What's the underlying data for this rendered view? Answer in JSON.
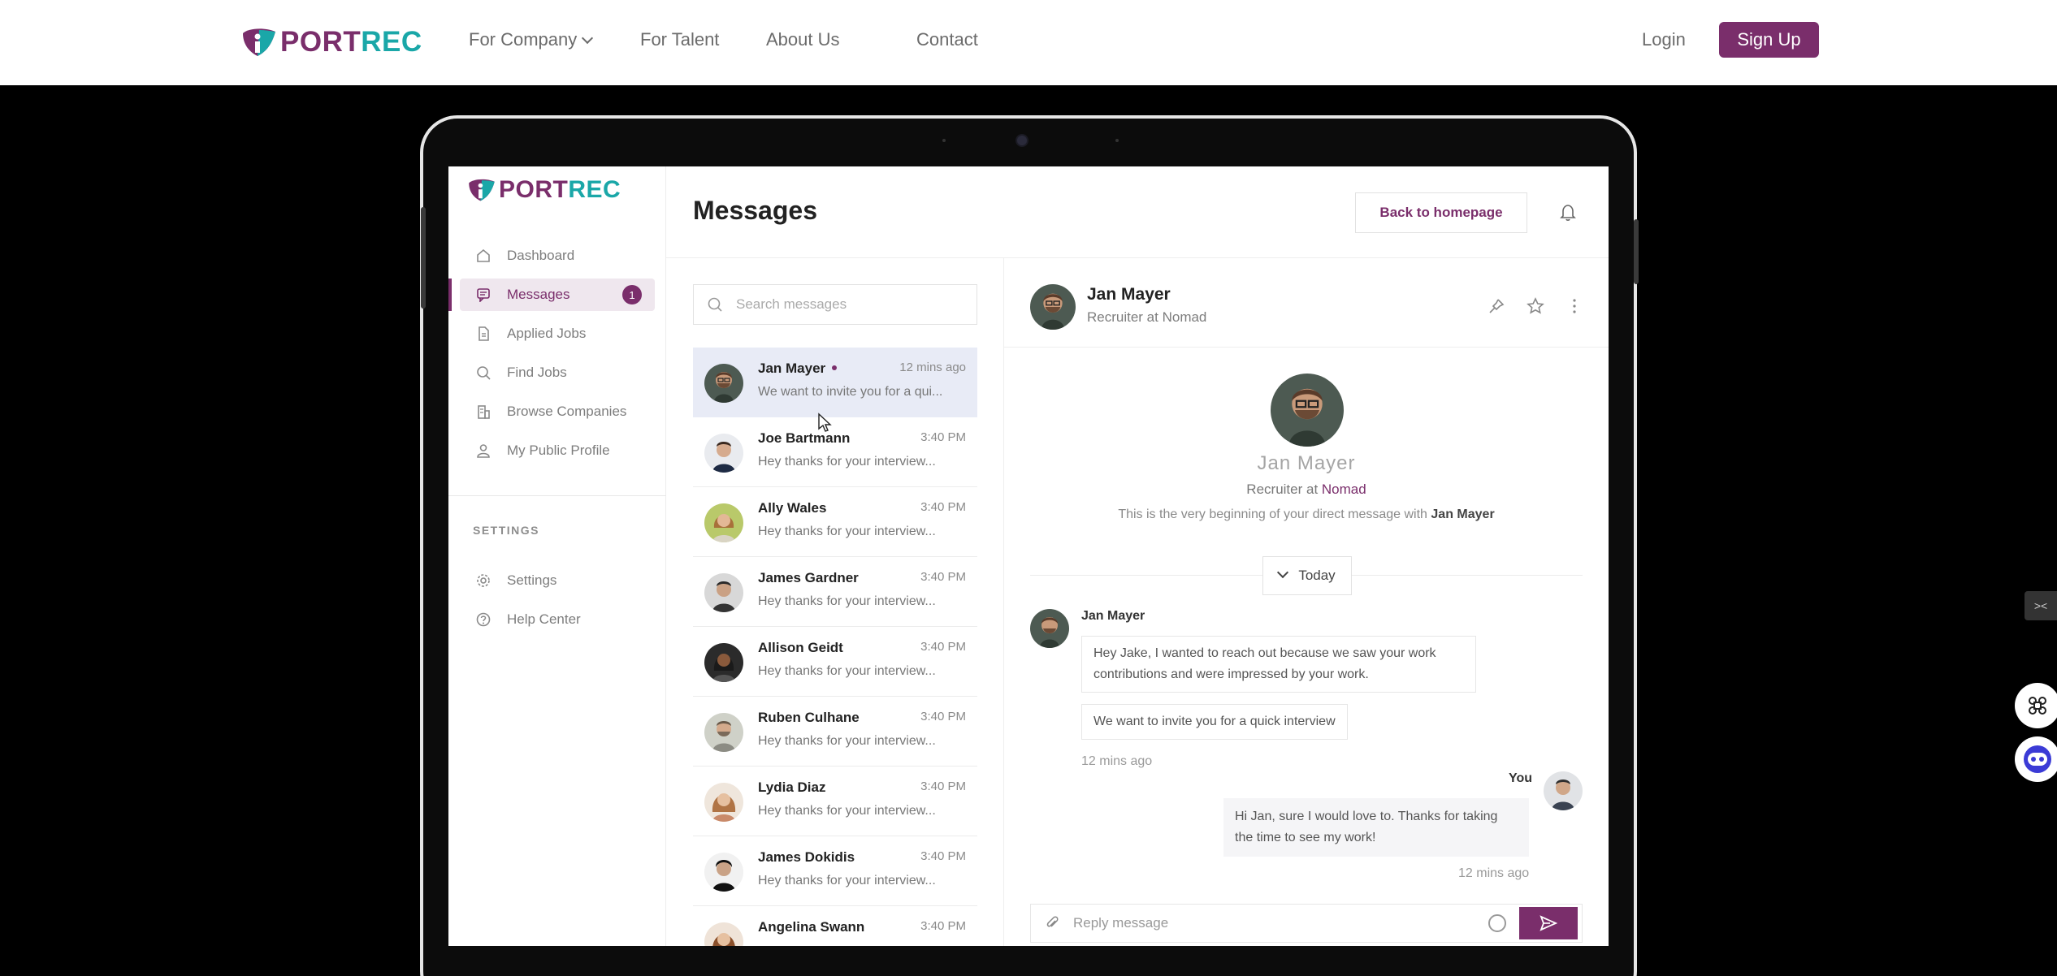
{
  "site_nav": {
    "logo_part1": "PORT",
    "logo_part2": "REC",
    "links": [
      "For Company",
      "For Talent",
      "About Us",
      "Contact"
    ],
    "login": "Login",
    "signup": "Sign Up"
  },
  "app": {
    "logo_part1": "PORT",
    "logo_part2": "REC",
    "sidebar": {
      "items": [
        {
          "label": "Dashboard",
          "icon": "home-icon"
        },
        {
          "label": "Messages",
          "icon": "chat-icon",
          "badge": "1",
          "active": true
        },
        {
          "label": "Applied Jobs",
          "icon": "document-icon"
        },
        {
          "label": "Find Jobs",
          "icon": "search-icon"
        },
        {
          "label": "Browse Companies",
          "icon": "building-icon"
        },
        {
          "label": "My Public Profile",
          "icon": "user-icon"
        }
      ],
      "section_title": "SETTINGS",
      "settings_items": [
        {
          "label": "Settings",
          "icon": "gear-icon"
        },
        {
          "label": "Help Center",
          "icon": "help-icon"
        }
      ]
    },
    "header": {
      "title": "Messages",
      "back_button": "Back to homepage"
    },
    "search": {
      "placeholder": "Search messages"
    },
    "conversations": [
      {
        "name": "Jan Mayer",
        "time": "12 mins ago",
        "preview": "We want to invite you for a qui...",
        "unread": true,
        "selected": true
      },
      {
        "name": "Joe Bartmann",
        "time": "3:40 PM",
        "preview": "Hey thanks for your interview..."
      },
      {
        "name": "Ally Wales",
        "time": "3:40 PM",
        "preview": "Hey thanks for your interview..."
      },
      {
        "name": "James Gardner",
        "time": "3:40 PM",
        "preview": "Hey thanks for your interview..."
      },
      {
        "name": "Allison Geidt",
        "time": "3:40 PM",
        "preview": "Hey thanks for your interview..."
      },
      {
        "name": "Ruben Culhane",
        "time": "3:40 PM",
        "preview": "Hey thanks for your interview..."
      },
      {
        "name": "Lydia Diaz",
        "time": "3:40 PM",
        "preview": "Hey thanks for your interview..."
      },
      {
        "name": "James Dokidis",
        "time": "3:40 PM",
        "preview": "Hey thanks for your interview..."
      },
      {
        "name": "Angelina Swann",
        "time": "3:40 PM",
        "preview": ""
      }
    ],
    "chat": {
      "contact_name": "Jan Mayer",
      "contact_role": "Recruiter at Nomad",
      "intro_name": "Jan Mayer",
      "intro_role_prefix": "Recruiter at ",
      "intro_company": "Nomad",
      "intro_text": "This is the very beginning of your direct message with ",
      "intro_text_name": "Jan Mayer",
      "day_separator": "Today",
      "incoming_sender": "Jan Mayer",
      "incoming_messages": [
        "Hey Jake, I wanted to reach out because we saw your work contributions and were impressed by your work.",
        "We want to invite you for a quick interview"
      ],
      "incoming_time": "12 mins ago",
      "outgoing_sender": "You",
      "outgoing_message": "Hi Jan, sure I would love to. Thanks for taking the time to see my work!",
      "outgoing_time": "12 mins ago",
      "reply_placeholder": "Reply message"
    }
  },
  "colors": {
    "brand_purple": "#7a2e6b",
    "brand_teal": "#1aa7a8",
    "selected_row": "#e8ebf6"
  }
}
